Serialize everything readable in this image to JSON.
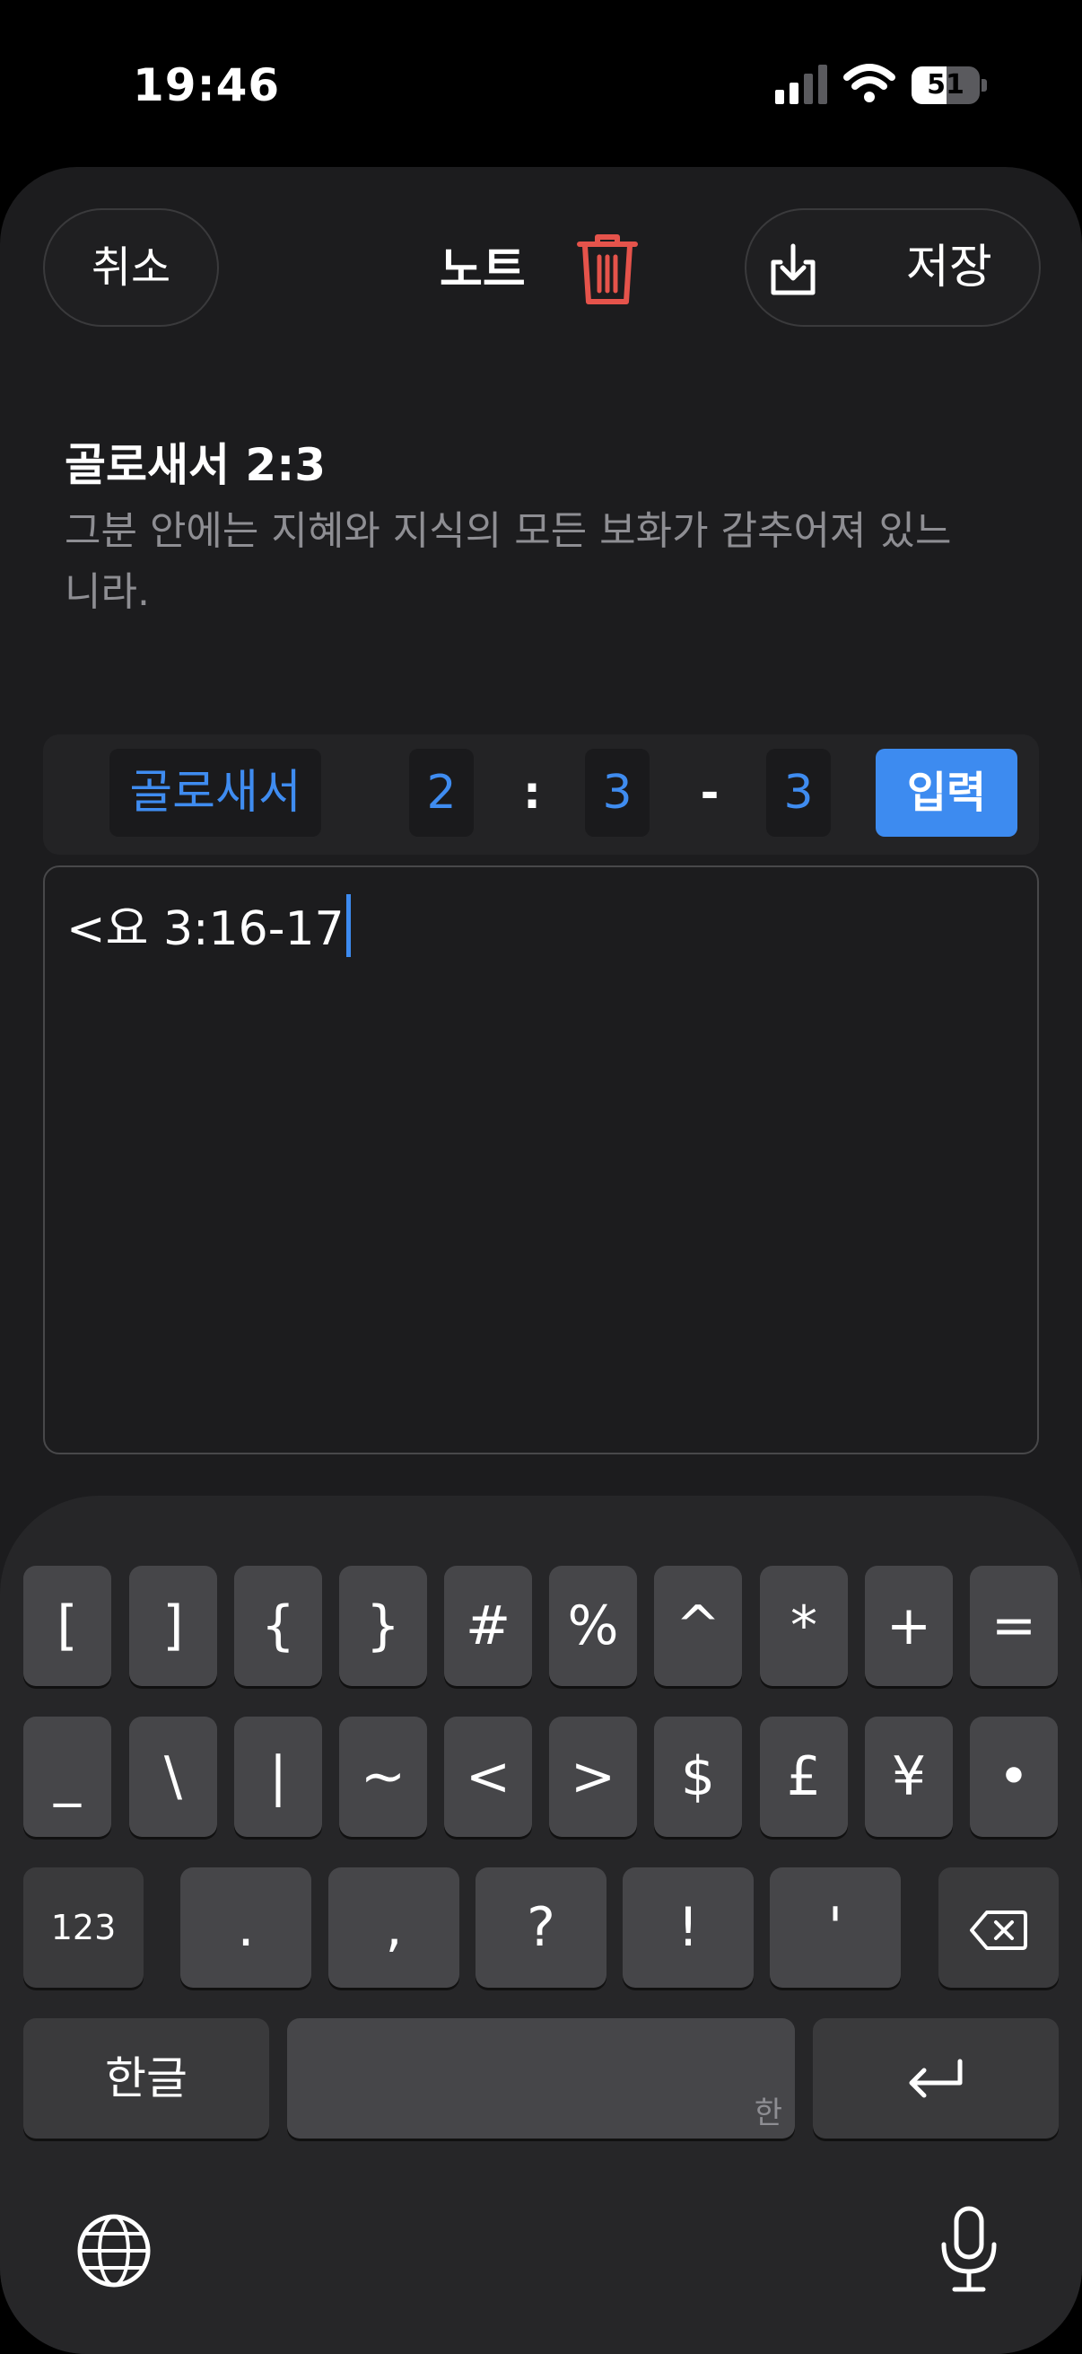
{
  "status": {
    "time": "19:46",
    "battery": "51",
    "battery_level": 0.51
  },
  "header": {
    "cancel": "취소",
    "title": "노트",
    "save": "저장"
  },
  "reference": {
    "title": "골로새서 2:3",
    "text": "그분 안에는 지혜와 지식의 모든 보화가 감추어져 있느니라."
  },
  "selector": {
    "book": "골로새서",
    "chapter": "2",
    "colon": ":",
    "verse_start": "3",
    "dash": "-",
    "verse_end": "3",
    "input": "입력"
  },
  "editor": {
    "text": "<요 3:16-17"
  },
  "keyboard": {
    "row1": [
      "[",
      "]",
      "{",
      "}",
      "#",
      "%",
      "^",
      "*",
      "+",
      "="
    ],
    "row2": [
      "_",
      "\\",
      "|",
      "~",
      "<",
      ">",
      "$",
      "£",
      "¥",
      "•"
    ],
    "row3": {
      "mode": "123",
      "keys": [
        ".",
        ",",
        "?",
        "!",
        "'"
      ]
    },
    "row4": {
      "lang": "한글",
      "space_hint": "한"
    }
  },
  "icons": [
    "trash-icon",
    "save-download-icon",
    "backspace-icon",
    "return-icon",
    "globe-icon",
    "microphone-icon",
    "cellular-signal-icon",
    "wifi-icon"
  ],
  "colors": {
    "accent": "#3d8bf0",
    "delete": "#e5534b",
    "background": "#1c1c1e"
  }
}
